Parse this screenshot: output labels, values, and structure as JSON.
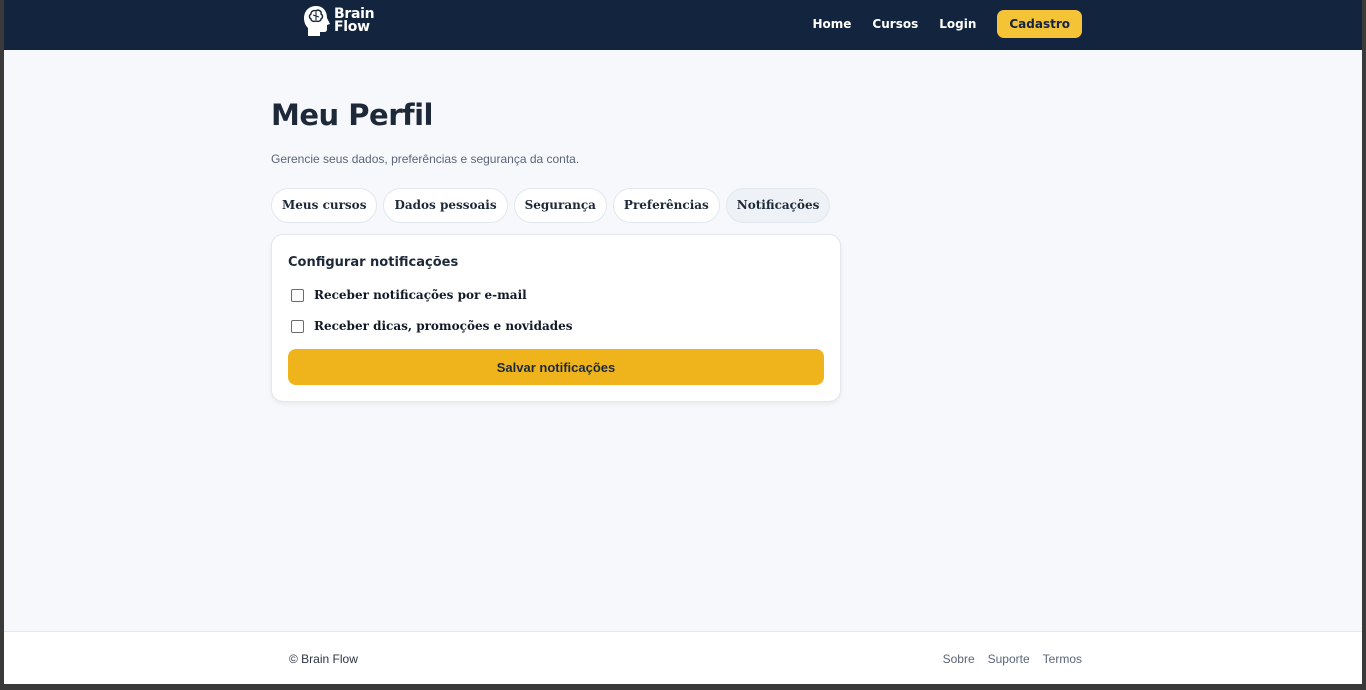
{
  "brand": {
    "line1": "Brain",
    "line2": "Flow"
  },
  "nav": {
    "home": "Home",
    "cursos": "Cursos",
    "login": "Login",
    "cadastro": "Cadastro"
  },
  "profile": {
    "title": "Meu Perfil",
    "subtitle": "Gerencie seus dados, preferências e segurança da conta."
  },
  "tabs": [
    {
      "label": "Meus cursos",
      "active": false
    },
    {
      "label": "Dados pessoais",
      "active": false
    },
    {
      "label": "Segurança",
      "active": false
    },
    {
      "label": "Preferências",
      "active": false
    },
    {
      "label": "Notificações",
      "active": true
    }
  ],
  "notifications": {
    "title": "Configurar notificações",
    "email_label": "Receber notificações por e-mail",
    "email_checked": false,
    "promo_label": "Receber dicas, promoções e novidades",
    "promo_checked": false,
    "save_label": "Salvar notificações"
  },
  "footer": {
    "copyright": "© Brain Flow",
    "links": [
      "Sobre",
      "Suporte",
      "Termos"
    ]
  },
  "colors": {
    "header_bg": "#13243f",
    "accent": "#f5c336",
    "button": "#efb41c",
    "page_bg": "#f6f8fb"
  },
  "icons": {
    "logo": "brain-head-icon"
  }
}
